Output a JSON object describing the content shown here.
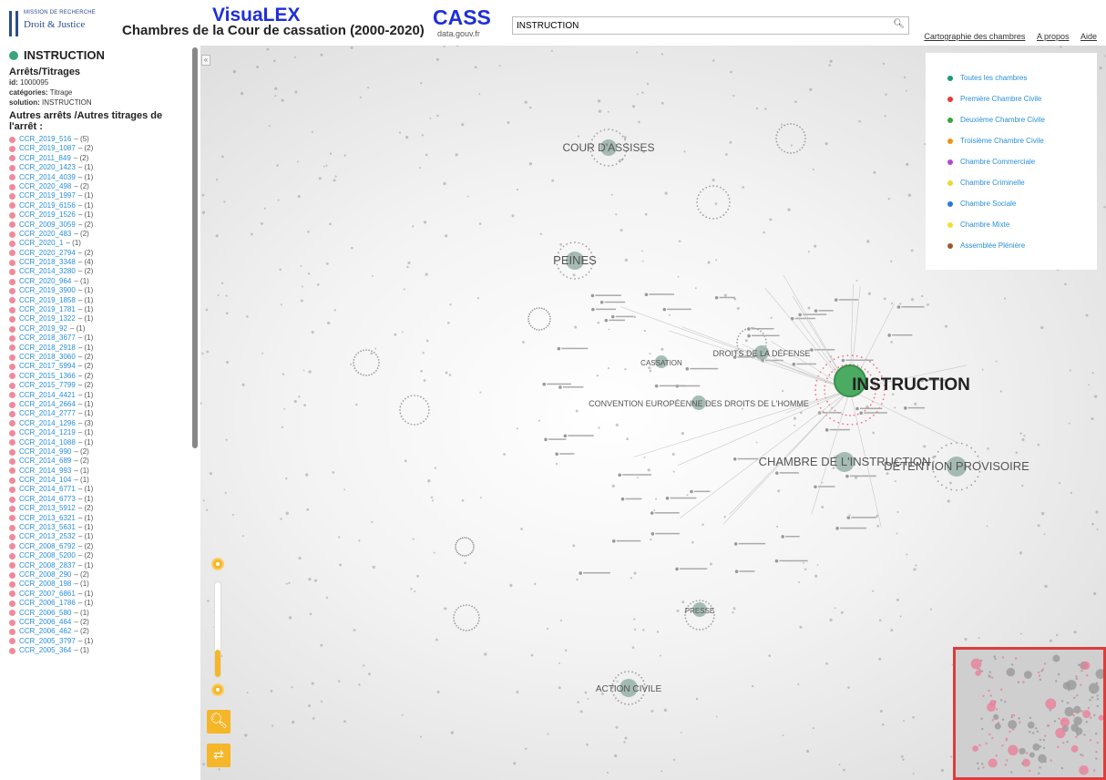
{
  "header": {
    "logo_line1": "MISSION DE RECHERCHE",
    "logo_line2": "Droit & Justice",
    "app_title": "VisuaLEX",
    "subtitle": "Chambres de la Cour de cassation (2000-2020)",
    "cass_title": "CASS",
    "cass_sub": "data.gouv.fr",
    "search_value": "INSTRUCTION",
    "links": [
      "Cartographie des chambres",
      "A propos",
      "Aide"
    ]
  },
  "sidebar": {
    "node_title": "INSTRUCTION",
    "section_title": "Arrêts/Titrages",
    "id_label": "id:",
    "id_value": "1000095",
    "categories_label": "catégories:",
    "categories_value": "Titrage",
    "solution_label": "solution:",
    "solution_value": "INSTRUCTION",
    "autres_title": "Autres arrêts /Autres titrages de l'arrêt :",
    "arrets": [
      {
        "id": "CCR_2019_516",
        "count": "(5)"
      },
      {
        "id": "CCR_2019_1087",
        "count": "(2)"
      },
      {
        "id": "CCR_2011_849",
        "count": "(2)"
      },
      {
        "id": "CCR_2020_1423",
        "count": "(1)"
      },
      {
        "id": "CCR_2014_4039",
        "count": "(1)"
      },
      {
        "id": "CCR_2020_498",
        "count": "(2)"
      },
      {
        "id": "CCR_2019_1997",
        "count": "(1)"
      },
      {
        "id": "CCR_2019_6156",
        "count": "(1)"
      },
      {
        "id": "CCR_2019_1526",
        "count": "(1)"
      },
      {
        "id": "CCR_2009_3059",
        "count": "(2)"
      },
      {
        "id": "CCR_2020_483",
        "count": "(2)"
      },
      {
        "id": "CCR_2020_1",
        "count": "(1)"
      },
      {
        "id": "CCR_2020_2794",
        "count": "(2)"
      },
      {
        "id": "CCR_2018_3348",
        "count": "(4)"
      },
      {
        "id": "CCR_2014_3280",
        "count": "(2)"
      },
      {
        "id": "CCR_2020_964",
        "count": "(1)"
      },
      {
        "id": "CCR_2019_3900",
        "count": "(1)"
      },
      {
        "id": "CCR_2019_1858",
        "count": "(1)"
      },
      {
        "id": "CCR_2019_1781",
        "count": "(1)"
      },
      {
        "id": "CCR_2019_1322",
        "count": "(1)"
      },
      {
        "id": "CCR_2019_92",
        "count": "(1)"
      },
      {
        "id": "CCR_2018_3677",
        "count": "(1)"
      },
      {
        "id": "CCR_2018_2918",
        "count": "(1)"
      },
      {
        "id": "CCR_2018_3060",
        "count": "(2)"
      },
      {
        "id": "CCR_2017_5994",
        "count": "(2)"
      },
      {
        "id": "CCR_2015_1366",
        "count": "(2)"
      },
      {
        "id": "CCR_2015_7799",
        "count": "(2)"
      },
      {
        "id": "CCR_2014_4421",
        "count": "(1)"
      },
      {
        "id": "CCR_2014_2664",
        "count": "(1)"
      },
      {
        "id": "CCR_2014_2777",
        "count": "(1)"
      },
      {
        "id": "CCR_2014_1296",
        "count": "(3)"
      },
      {
        "id": "CCR_2014_1219",
        "count": "(1)"
      },
      {
        "id": "CCR_2014_1088",
        "count": "(1)"
      },
      {
        "id": "CCR_2014_990",
        "count": "(2)"
      },
      {
        "id": "CCR_2014_689",
        "count": "(2)"
      },
      {
        "id": "CCR_2014_993",
        "count": "(1)"
      },
      {
        "id": "CCR_2014_104",
        "count": "(1)"
      },
      {
        "id": "CCR_2014_6771",
        "count": "(1)"
      },
      {
        "id": "CCR_2014_6773",
        "count": "(1)"
      },
      {
        "id": "CCR_2013_5912",
        "count": "(2)"
      },
      {
        "id": "CCR_2013_6321",
        "count": "(1)"
      },
      {
        "id": "CCR_2013_5631",
        "count": "(1)"
      },
      {
        "id": "CCR_2013_2532",
        "count": "(1)"
      },
      {
        "id": "CCR_2008_6792",
        "count": "(2)"
      },
      {
        "id": "CCR_2008_5200",
        "count": "(2)"
      },
      {
        "id": "CCR_2008_2837",
        "count": "(1)"
      },
      {
        "id": "CCR_2008_290",
        "count": "(2)"
      },
      {
        "id": "CCR_2008_198",
        "count": "(1)"
      },
      {
        "id": "CCR_2007_6861",
        "count": "(1)"
      },
      {
        "id": "CCR_2006_1786",
        "count": "(1)"
      },
      {
        "id": "CCR_2006_580",
        "count": "(1)"
      },
      {
        "id": "CCR_2006_464",
        "count": "(2)"
      },
      {
        "id": "CCR_2006_462",
        "count": "(2)"
      },
      {
        "id": "CCR_2005_3797",
        "count": "(1)"
      },
      {
        "id": "CCR_2005_364",
        "count": "(1)"
      }
    ]
  },
  "legend": [
    {
      "label": "Toutes les chambres",
      "color": "#1a9a7a"
    },
    {
      "label": "Première Chambre Civile",
      "color": "#e83a3a"
    },
    {
      "label": "Deuxième Chambre Civile",
      "color": "#3aa53a"
    },
    {
      "label": "Troisième Chambre Civile",
      "color": "#f0901a"
    },
    {
      "label": "Chambre Commerciale",
      "color": "#b04ad0"
    },
    {
      "label": "Chambre Criminelle",
      "color": "#e8d83a"
    },
    {
      "label": "Chambre Sociale",
      "color": "#2a7ad6"
    },
    {
      "label": "Chambre Mixte",
      "color": "#f0e030"
    },
    {
      "label": "Assemblée Plénière",
      "color": "#9a5a30"
    }
  ],
  "graph": {
    "main_label": "INSTRUCTION",
    "labels": [
      "COUR D'ASSISES",
      "PEINES",
      "DROITS DE LA DÉFENSE",
      "CASSATION",
      "CONVENTION EUROPÉENNE DES DROITS DE L'HOMME",
      "CHAMBRE DE L'INSTRUCTION",
      "DÉTENTION PROVISOIRE",
      "ACTION CIVILE",
      "PRESSE"
    ]
  }
}
